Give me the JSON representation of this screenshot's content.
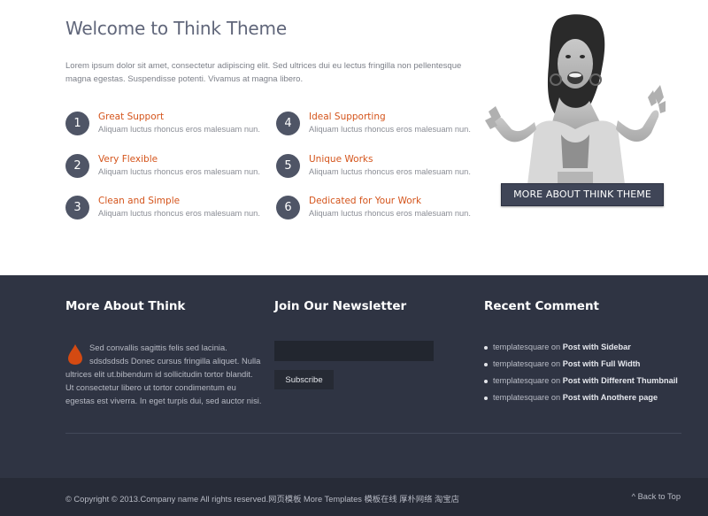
{
  "welcome": {
    "title": "Welcome to Think Theme",
    "intro": "Lorem ipsum dolor sit amet, consectetur adipiscing elit. Sed ultrices dui eu lectus fringilla non pellentesque magna egestas. Suspendisse potenti. Vivamus at magna libero."
  },
  "features": [
    {
      "num": "1",
      "title": "Great Support",
      "desc": "Aliquam luctus rhoncus eros malesuam nun."
    },
    {
      "num": "2",
      "title": "Very Flexible",
      "desc": "Aliquam luctus rhoncus eros malesuam nun."
    },
    {
      "num": "3",
      "title": "Clean and Simple",
      "desc": "Aliquam luctus rhoncus eros malesuam nun."
    },
    {
      "num": "4",
      "title": "Ideal Supporting",
      "desc": "Aliquam luctus rhoncus eros malesuam nun."
    },
    {
      "num": "5",
      "title": "Unique Works",
      "desc": "Aliquam luctus rhoncus eros malesuam nun."
    },
    {
      "num": "6",
      "title": "Dedicated for Your Work",
      "desc": "Aliquam luctus rhoncus eros malesuam nun."
    }
  ],
  "more_button": "MORE ABOUT THINK THEME",
  "footer": {
    "about": {
      "title": "More About Think",
      "text": "Sed convallis sagittis felis sed lacinia. sdsdsdsds Donec cursus fringilla aliquet. Nulla ultrices elit ut.bibendum id sollicitudin tortor blandit. Ut consectetur libero ut tortor condimentum eu egestas est viverra. In eget turpis dui, sed auctor nisi."
    },
    "newsletter": {
      "title": "Join Our Newsletter",
      "input_value": "",
      "subscribe": "Subscribe"
    },
    "recent": {
      "title": "Recent Comment",
      "items": [
        {
          "author": "templatesquare",
          "on": "on",
          "post": "Post with Sidebar"
        },
        {
          "author": "templatesquare",
          "on": "on",
          "post": "Post with Full Width"
        },
        {
          "author": "templatesquare",
          "on": "on",
          "post": "Post with Different Thumbnail"
        },
        {
          "author": "templatesquare",
          "on": "on",
          "post": "Post with Anothere page"
        }
      ]
    },
    "copyright": "© Copyright © 2013.Company name All rights reserved.网页模板 More Templates 模板在线 厚朴网络 淘宝店",
    "back_to_top": "^ Back to Top"
  },
  "colors": {
    "accent": "#d4541b",
    "footer_bg": "#2f3443",
    "bottom_bar_bg": "#272b37",
    "button_bg": "#3f4557",
    "number_circle": "#4f5566"
  },
  "icons": {
    "drop": "water-drop-icon",
    "bullet": "bullet-icon"
  }
}
